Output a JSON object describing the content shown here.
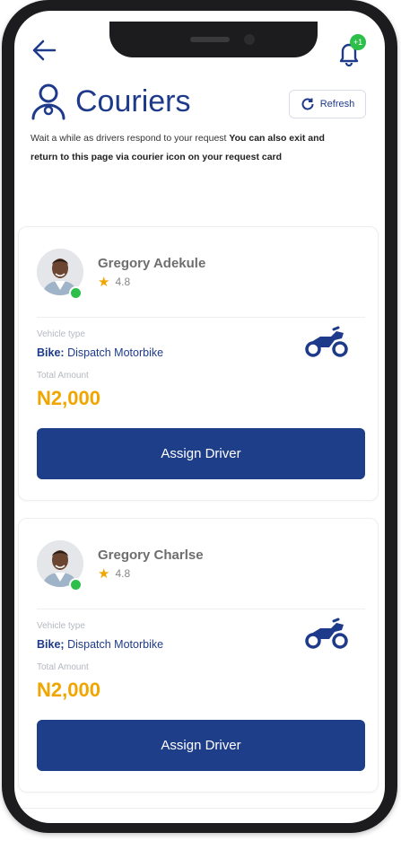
{
  "header": {
    "title": "Couriers",
    "refresh_label": "Refresh",
    "notification_badge": "+1",
    "subtitle_plain": "Wait a while  as drivers respond to your request",
    "subtitle_bold": "You can also exit and return to this page  via courier icon on your request card"
  },
  "couriers": [
    {
      "name": "Gregory Adekule",
      "rating": "4.8",
      "vehicle_label": "Vehicle type",
      "vehicle_type_bold": "Bike:",
      "vehicle_type": "Dispatch Motorbike",
      "amount_label": "Total Amount",
      "amount": "N2,000",
      "button_label": "Assign Driver"
    },
    {
      "name": "Gregory Charlse",
      "rating": "4.8",
      "vehicle_label": "Vehicle type",
      "vehicle_type_bold": "Bike;",
      "vehicle_type": "Dispatch Motorbike",
      "amount_label": "Total Amount",
      "amount": "N2,000",
      "button_label": "Assign Driver"
    }
  ],
  "icons": {
    "back": "arrow-left-icon",
    "notifications": "bell-icon",
    "title": "user-icon",
    "refresh": "refresh-icon",
    "rating": "star-icon",
    "vehicle": "motorbike-icon"
  },
  "colors": {
    "primary": "#1e3a8a",
    "button": "#1e3e8a",
    "amount": "#f0a500",
    "online": "#2dbf4a"
  }
}
